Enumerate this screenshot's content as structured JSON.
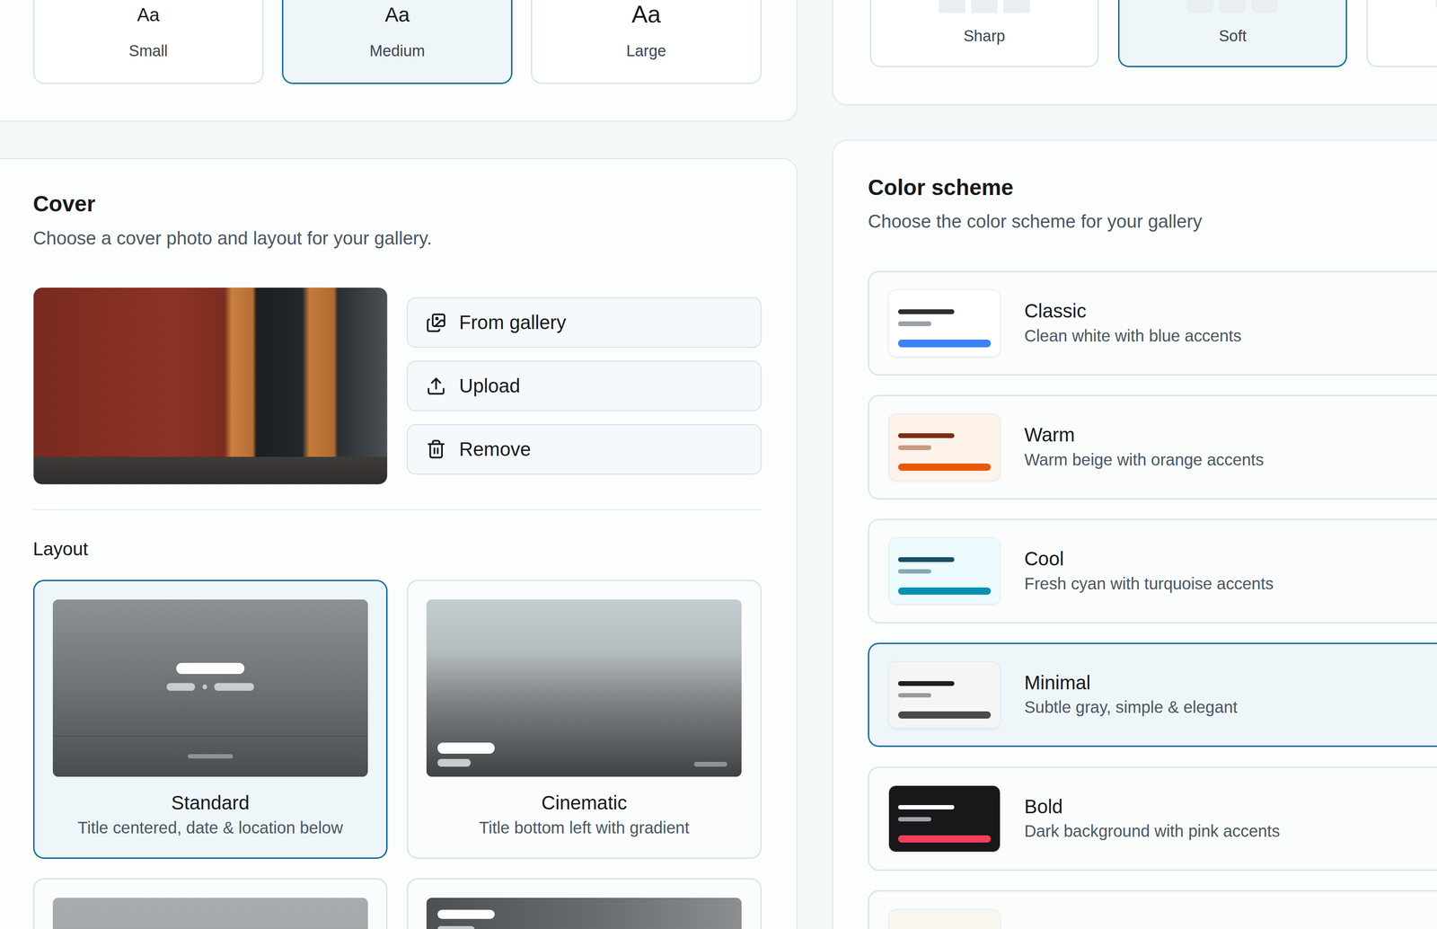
{
  "fontSize": {
    "options": [
      {
        "sample": "Aa",
        "label": "Small",
        "kind": "small",
        "selected": false
      },
      {
        "sample": "Aa",
        "label": "Medium",
        "kind": "medium",
        "selected": true
      },
      {
        "sample": "Aa",
        "label": "Large",
        "kind": "large",
        "selected": false
      }
    ]
  },
  "corners": {
    "options": [
      {
        "label": "Sharp",
        "kind": "sharp",
        "selected": false
      },
      {
        "label": "Soft",
        "kind": "soft",
        "selected": true
      },
      {
        "label": "",
        "kind": "round",
        "selected": false
      }
    ]
  },
  "cover": {
    "title": "Cover",
    "subtitle": "Choose a cover photo and layout for your gallery.",
    "actions": [
      {
        "label": "From gallery",
        "kind": "gallery"
      },
      {
        "label": "Upload",
        "kind": "upload"
      },
      {
        "label": "Remove",
        "kind": "remove"
      }
    ],
    "layout": {
      "label": "Layout",
      "options": [
        {
          "title": "Standard",
          "description": "Title centered, date & location below",
          "kind": "standard",
          "selected": true
        },
        {
          "title": "Cinematic",
          "description": "Title bottom left with gradient",
          "kind": "cinematic",
          "selected": false
        },
        {
          "title": "",
          "description": "",
          "kind": "light",
          "selected": false
        },
        {
          "title": "",
          "description": "",
          "kind": "overlay",
          "selected": false
        }
      ]
    }
  },
  "colorScheme": {
    "title": "Color scheme",
    "subtitle": "Choose the color scheme for your gallery",
    "schemes": [
      {
        "name": "Classic",
        "description": "Clean white with blue accents",
        "selected": false,
        "color": "#3b82f6",
        "background": "#ffffff",
        "ink": "#2b2f33",
        "muted": "#9aa0a6"
      },
      {
        "name": "Warm",
        "description": "Warm beige with orange accents",
        "selected": false,
        "color": "#ea580c",
        "background": "#fdf3ea",
        "ink": "#7c2d12",
        "muted": "#c79a82"
      },
      {
        "name": "Cool",
        "description": "Fresh cyan with turquoise accents",
        "selected": false,
        "color": "#0891b2",
        "background": "#ecfbfd",
        "ink": "#164e63",
        "muted": "#8aa6b0"
      },
      {
        "name": "Minimal",
        "description": "Subtle gray, simple & elegant",
        "selected": true,
        "color": "#4a4a4a",
        "background": "#f5f5f5",
        "ink": "#1f1f1f",
        "muted": "#9a9a9a"
      },
      {
        "name": "Bold",
        "description": "Dark background with pink accents",
        "selected": false,
        "color": "#f43f5e",
        "background": "#18181b",
        "ink": "#ffffff",
        "muted": "#a1a1aa"
      },
      {
        "name": "",
        "description": "",
        "selected": false,
        "color": "#a3835c",
        "background": "#faf6f0",
        "ink": "#3f3328",
        "muted": "#b9a993"
      }
    ]
  }
}
